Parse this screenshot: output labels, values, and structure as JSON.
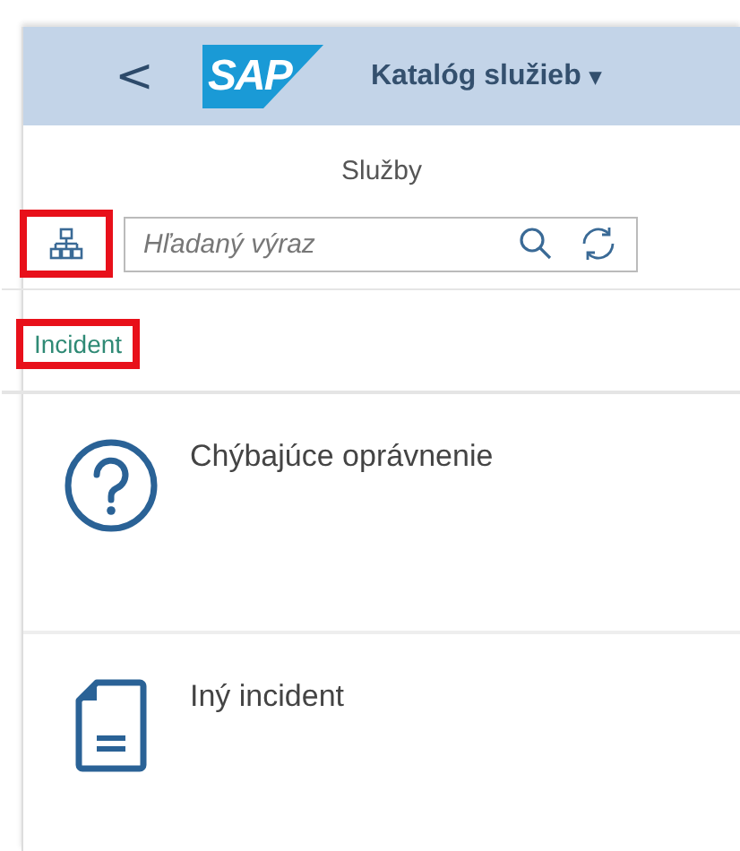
{
  "header": {
    "back": "<",
    "logo": "SAP",
    "title": "Katalóg služieb",
    "menu_caret": "▾"
  },
  "page_title": "Služby",
  "toolbar": {
    "hierarchy_highlighted": true,
    "search": {
      "placeholder": "Hľadaný výraz"
    }
  },
  "categories": [
    {
      "label": "Incident",
      "selected": true,
      "highlighted": true
    }
  ],
  "tiles": [
    {
      "kind": "question",
      "title": "Chýbajúce oprávnenie"
    },
    {
      "kind": "document",
      "title": "Iný incident"
    }
  ]
}
